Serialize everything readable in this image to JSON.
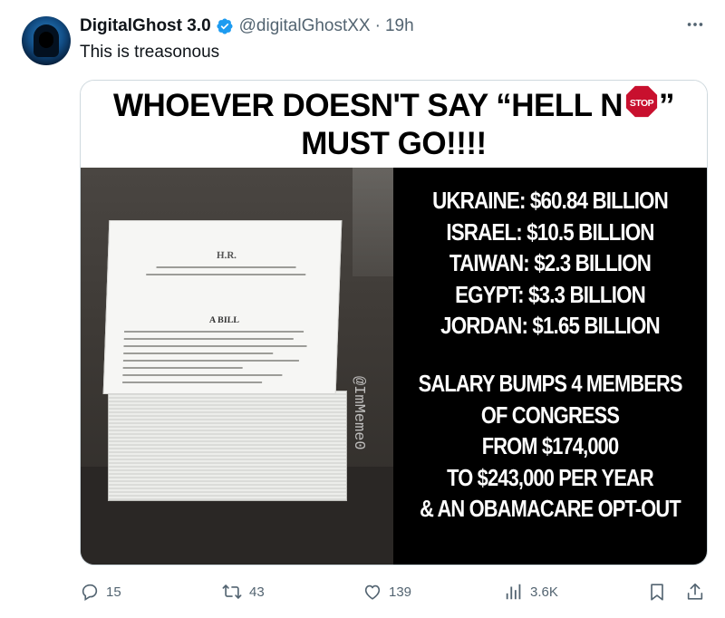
{
  "tweet": {
    "display_name": "DigitalGhost 3.0",
    "handle": "@digitalGhostXX",
    "separator": "·",
    "time": "19h",
    "text": "This is treasonous",
    "verified_color": "#1d9bf0"
  },
  "media": {
    "headline_line1": "WHOEVER DOESN'T SAY “HELL N",
    "headline_line1_end": "”",
    "stop_sign_text": "STOP",
    "headline_line2": "MUST GO!!!!",
    "watermark": "@ImMeme0",
    "document": {
      "title": "H.R.",
      "subtitle": "A BILL"
    },
    "aid_lines": [
      "UKRAINE: $60.84 BILLION",
      "ISRAEL: $10.5 BILLION",
      "TAIWAN: $2.3 BILLION",
      "EGYPT: $3.3 BILLION",
      "JORDAN: $1.65 BILLION"
    ],
    "salary_lines": [
      "SALARY BUMPS 4 MEMBERS",
      "OF CONGRESS",
      "FROM $174,000",
      "TO $243,000 PER YEAR",
      "& AN OBAMACARE OPT-OUT"
    ]
  },
  "actions": {
    "replies": "15",
    "reposts": "43",
    "likes": "139",
    "views": "3.6K"
  },
  "icons": {
    "reply": "reply-icon",
    "repost": "repost-icon",
    "like": "heart-icon",
    "views": "views-icon",
    "bookmark": "bookmark-icon",
    "share": "share-icon",
    "more": "more-icon"
  }
}
